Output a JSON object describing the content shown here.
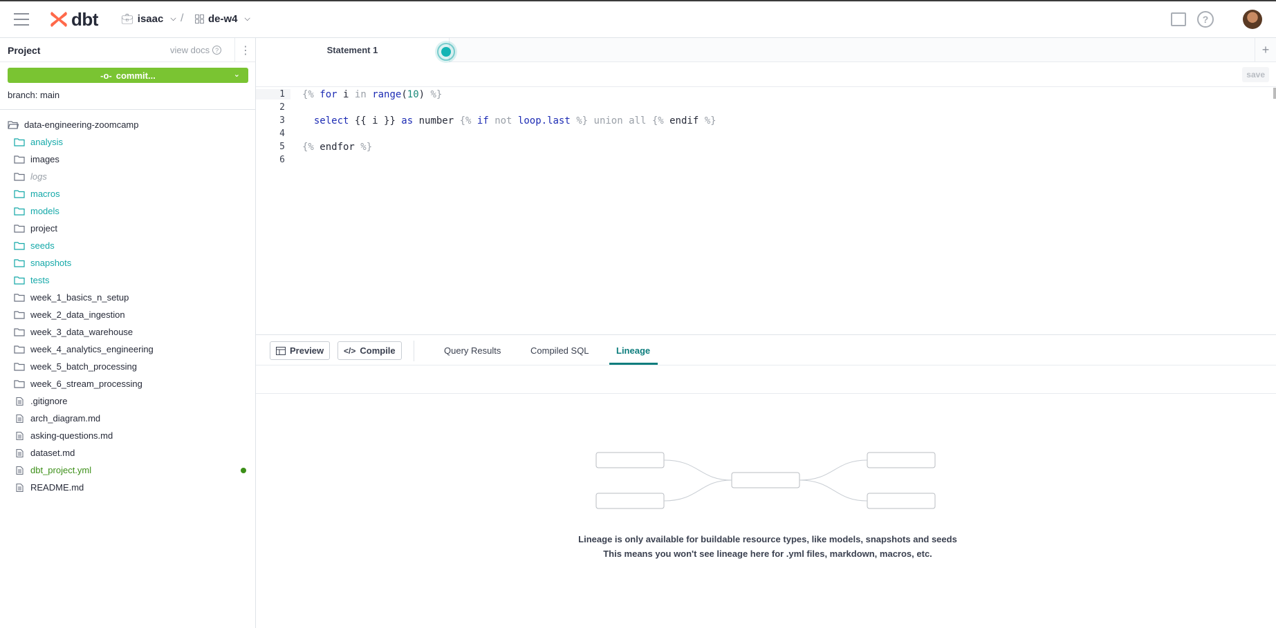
{
  "header": {
    "logo_text": "dbt",
    "account": "isaac",
    "project": "de-w4",
    "separator": "/"
  },
  "sidebar": {
    "title": "Project",
    "view_docs": "view docs",
    "commit_label": "commit...",
    "branch": "branch: main",
    "root_folder": "data-engineering-zoomcamp",
    "items": [
      {
        "label": "analysis",
        "type": "folder",
        "style": "teal"
      },
      {
        "label": "images",
        "type": "folder",
        "style": "dark"
      },
      {
        "label": "logs",
        "type": "folder",
        "style": "muted"
      },
      {
        "label": "macros",
        "type": "folder",
        "style": "teal"
      },
      {
        "label": "models",
        "type": "folder",
        "style": "teal"
      },
      {
        "label": "project",
        "type": "folder",
        "style": "dark"
      },
      {
        "label": "seeds",
        "type": "folder",
        "style": "teal"
      },
      {
        "label": "snapshots",
        "type": "folder",
        "style": "teal"
      },
      {
        "label": "tests",
        "type": "folder",
        "style": "teal"
      },
      {
        "label": "week_1_basics_n_setup",
        "type": "folder",
        "style": "dark"
      },
      {
        "label": "week_2_data_ingestion",
        "type": "folder",
        "style": "dark"
      },
      {
        "label": "week_3_data_warehouse",
        "type": "folder",
        "style": "dark"
      },
      {
        "label": "week_4_analytics_engineering",
        "type": "folder",
        "style": "dark"
      },
      {
        "label": "week_5_batch_processing",
        "type": "folder",
        "style": "dark"
      },
      {
        "label": "week_6_stream_processing",
        "type": "folder",
        "style": "dark"
      },
      {
        "label": ".gitignore",
        "type": "file",
        "style": "dark"
      },
      {
        "label": "arch_diagram.md",
        "type": "file",
        "style": "dark"
      },
      {
        "label": "asking-questions.md",
        "type": "file",
        "style": "dark"
      },
      {
        "label": "dataset.md",
        "type": "file",
        "style": "dark"
      },
      {
        "label": "dbt_project.yml",
        "type": "file",
        "style": "green",
        "modified": true
      },
      {
        "label": "README.md",
        "type": "file",
        "style": "dark"
      }
    ]
  },
  "editor": {
    "tab_label": "Statement 1",
    "save_label": "save",
    "line_numbers": [
      "1",
      "2",
      "3",
      "4",
      "5",
      "6"
    ],
    "lines": [
      "{% for i in range(10) %}",
      "",
      "  select {{ i }} as number {% if not loop.last %} union all {% endif %}",
      "",
      "{% endfor %}",
      ""
    ]
  },
  "panel": {
    "preview_label": "Preview",
    "compile_label": "Compile",
    "tabs": [
      "Query Results",
      "Compiled SQL",
      "Lineage"
    ],
    "active_tab": "Lineage",
    "lineage_message_line1": "Lineage is only available for buildable resource types, like models, snapshots and seeds",
    "lineage_message_line2": "This means you won't see lineage here for .yml files, markdown, macros, etc."
  },
  "colors": {
    "brand": "#ff694a",
    "commit_green": "#7ac432",
    "teal": "#13a8a8",
    "active_tab": "#0d7d7d"
  }
}
